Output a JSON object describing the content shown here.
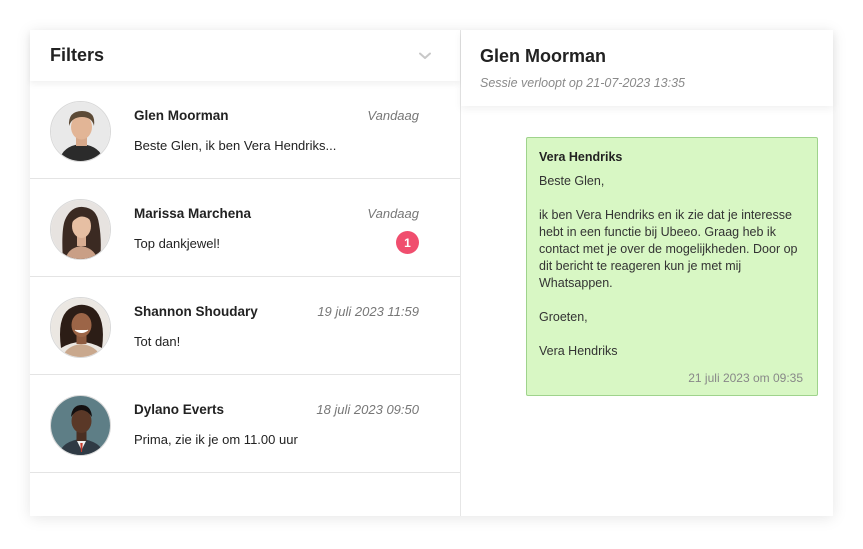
{
  "filters": {
    "title": "Filters",
    "toggle_icon": "chevron-down-icon"
  },
  "conversations": [
    {
      "name": "Glen Moorman",
      "time": "Vandaag",
      "preview": "Beste Glen, ik ben Vera Hendriks...",
      "unread": ""
    },
    {
      "name": "Marissa Marchena",
      "time": "Vandaag",
      "preview": "Top dankjewel!",
      "unread": "1"
    },
    {
      "name": "Shannon Shoudary",
      "time": "19 juli 2023 11:59",
      "preview": "Tot dan!",
      "unread": ""
    },
    {
      "name": "Dylano Everts",
      "time": "18 juli 2023 09:50",
      "preview": "Prima, zie ik je om 11.00 uur",
      "unread": ""
    }
  ],
  "chat": {
    "title": "Glen Moorman",
    "subtitle": "Sessie verloopt op 21-07-2023 13:35",
    "message": {
      "sender": "Vera Hendriks",
      "paragraphs": [
        "Beste Glen,",
        "ik ben Vera Hendriks en ik zie dat je interesse hebt in een functie bij Ubeeo. Graag heb ik contact met je over de mogelijkheden. Door op dit bericht te reageren kun je met mij Whatsappen.",
        "Groeten,",
        "Vera Hendriks"
      ],
      "timestamp": "21 juli 2023 om 09:35"
    }
  },
  "colors": {
    "bubble_bg": "#d8f7c4",
    "bubble_border": "#9fd38c",
    "badge": "#f04e6e"
  }
}
